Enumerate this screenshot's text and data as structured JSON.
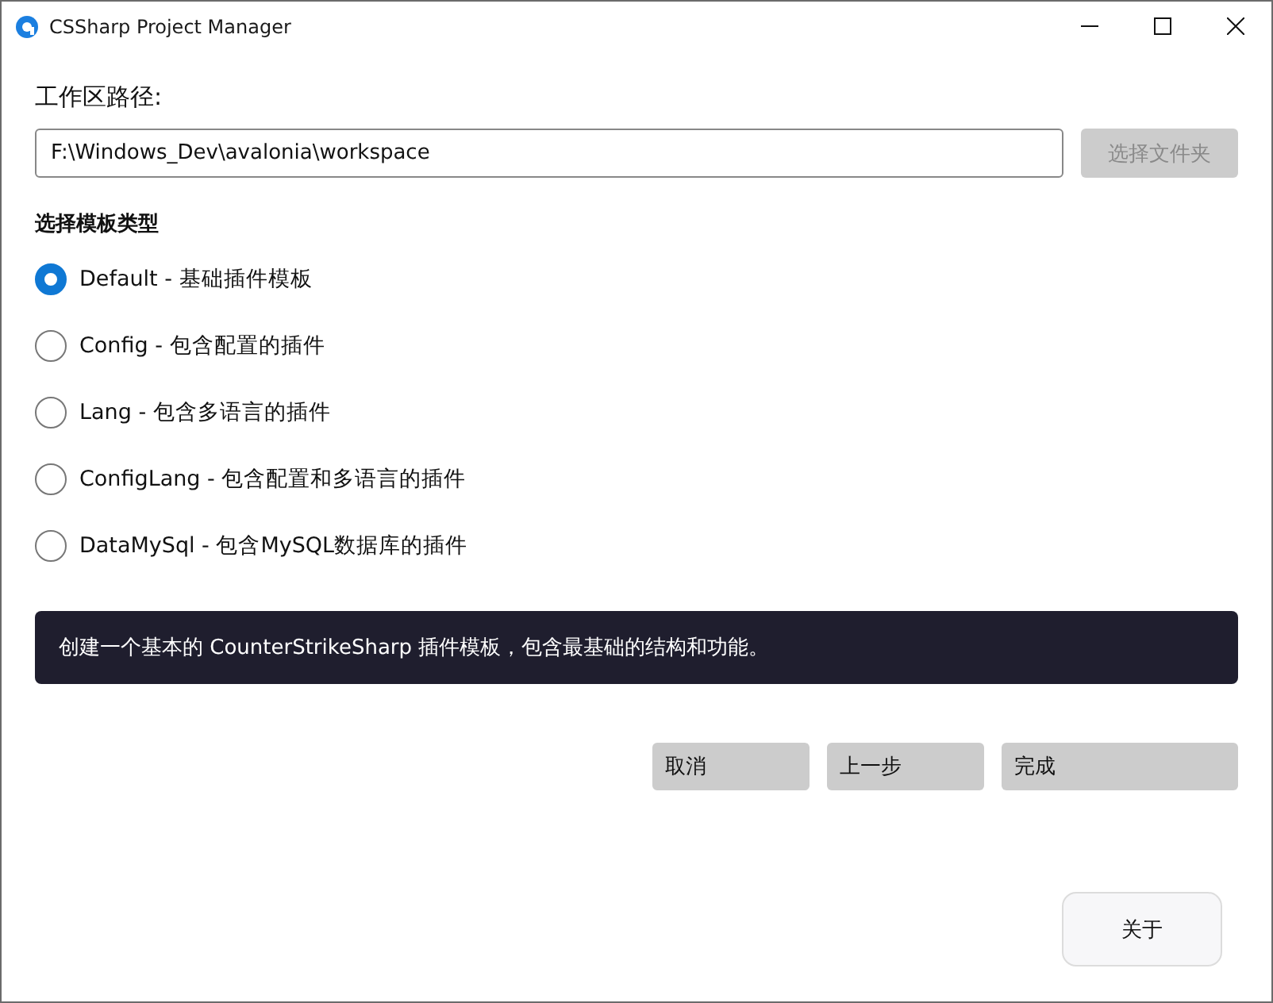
{
  "window": {
    "title": "CSSharp Project Manager"
  },
  "workspace": {
    "label": "工作区路径:",
    "value": "F:\\Windows_Dev\\avalonia\\workspace",
    "browse_button": {
      "label": "选择文件夹",
      "disabled": true
    }
  },
  "template": {
    "heading": "选择模板类型",
    "options": [
      {
        "label": "Default - 基础插件模板",
        "selected": true
      },
      {
        "label": "Config - 包含配置的插件",
        "selected": false
      },
      {
        "label": "Lang - 包含多语言的插件",
        "selected": false
      },
      {
        "label": "ConfigLang - 包含配置和多语言的插件",
        "selected": false
      },
      {
        "label": "DataMySql - 包含MySQL数据库的插件",
        "selected": false
      }
    ]
  },
  "description": "创建一个基本的 CounterStrikeSharp 插件模板，包含最基础的结构和功能。",
  "actions": [
    {
      "label": "取消",
      "kind": "narrow"
    },
    {
      "label": "上一步",
      "kind": "narrow"
    },
    {
      "label": "完成",
      "kind": "wide"
    }
  ],
  "about_button": "关于"
}
